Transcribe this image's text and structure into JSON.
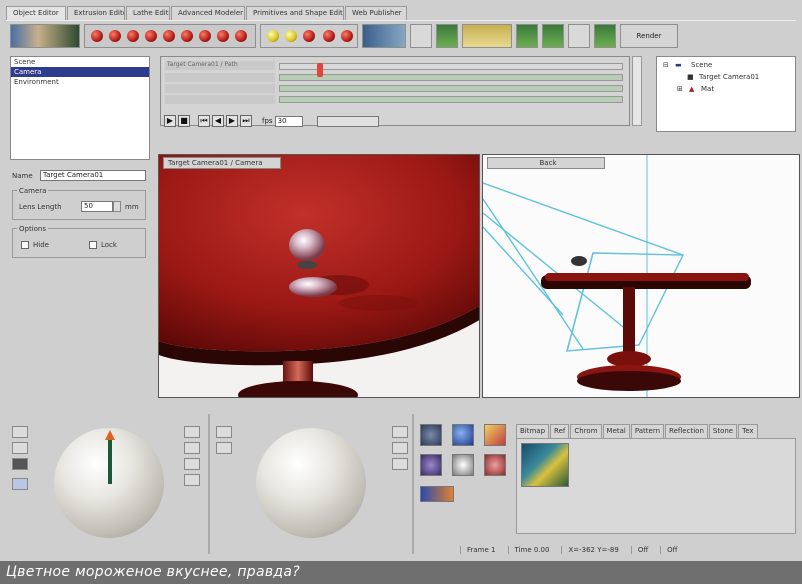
{
  "tabs": [
    {
      "label": "Object Editor"
    },
    {
      "label": "Extrusion Editor"
    },
    {
      "label": "Lathe Editor"
    },
    {
      "label": "Advanced Modeler"
    },
    {
      "label": "Primitives and Shape Editor"
    },
    {
      "label": "Web Publisher"
    }
  ],
  "toolbar": {
    "render_label": "Render"
  },
  "scene_list": {
    "items": [
      "Scene",
      "Camera",
      "Environment"
    ],
    "selected_index": 1
  },
  "properties": {
    "name_label": "Name",
    "name_value": "Target Camera01",
    "camera_group": "Camera",
    "lens_label": "Lens Length",
    "lens_value": "50",
    "lens_unit": "mm",
    "options_group": "Options",
    "option_1": "Hide",
    "option_2": "Lock"
  },
  "timeline": {
    "label": "Target Camera01 / Path",
    "fps_label": "fps",
    "fps_value": "30"
  },
  "tree": {
    "root": "Scene",
    "child_1": "Target Camera01",
    "child_2": "Mat"
  },
  "viewports": {
    "left_title": "Target Camera01 / Camera",
    "right_title": "Back"
  },
  "materials": {
    "tabs": [
      "Bitmap",
      "Ref",
      "Chrom",
      "Metal",
      "Pattern",
      "Reflection",
      "Stone",
      "Tex"
    ]
  },
  "status": {
    "frame": "Frame 1",
    "time": "Time 0.00",
    "coords": "X=-362 Y=-89",
    "mode": "Off",
    "mode2": "Off"
  },
  "caption": "Цветное мороженое вкуснее, правда?",
  "colors": {
    "table_red": "#a81c16",
    "selection_blue": "#2d3c8e",
    "camera_lines": "#5fc1dc",
    "caption_bg": "#6f6f6f"
  }
}
